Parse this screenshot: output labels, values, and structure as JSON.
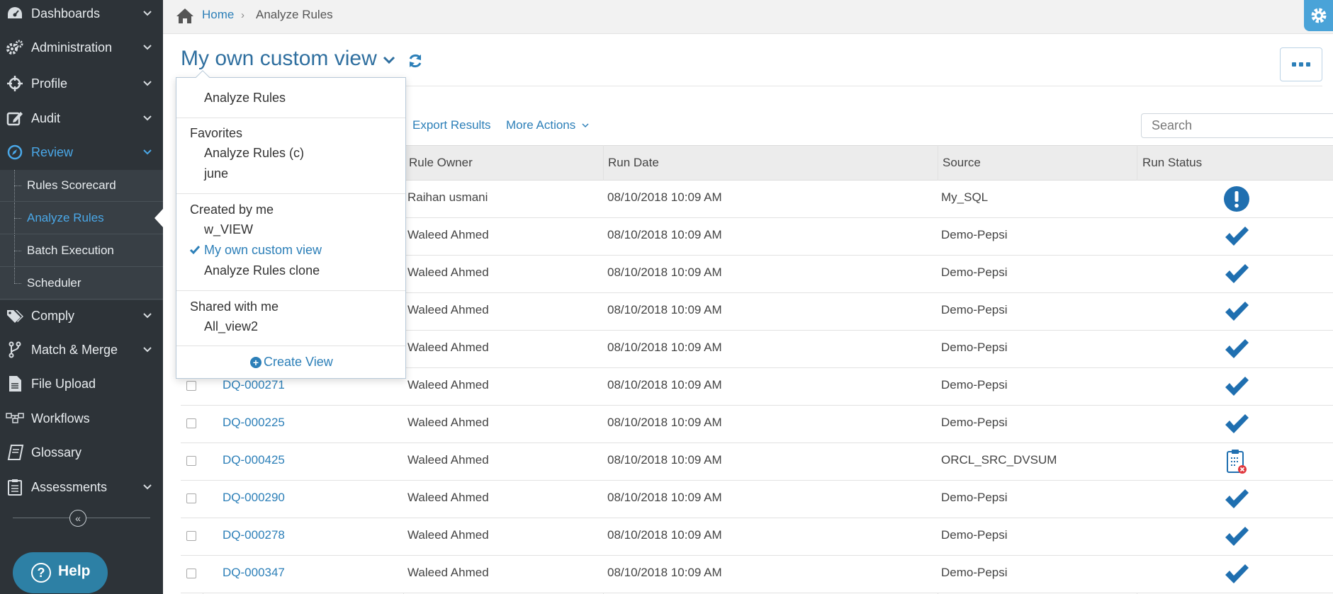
{
  "sidebar": {
    "items": [
      {
        "label": "Dashboards",
        "icon": "dashboard-icon"
      },
      {
        "label": "Administration",
        "icon": "gears-icon"
      },
      {
        "label": "Profile",
        "icon": "crosshair-icon"
      },
      {
        "label": "Audit",
        "icon": "edit-icon"
      },
      {
        "label": "Review",
        "icon": "compass-icon"
      },
      {
        "label": "Comply",
        "icon": "tags-icon"
      },
      {
        "label": "Match & Merge",
        "icon": "merge-icon"
      },
      {
        "label": "File Upload",
        "icon": "file-icon"
      },
      {
        "label": "Workflows",
        "icon": "workflow-icon"
      },
      {
        "label": "Glossary",
        "icon": "book-icon"
      },
      {
        "label": "Assessments",
        "icon": "clipboard-icon"
      }
    ],
    "sub_items": [
      {
        "label": "Rules Scorecard"
      },
      {
        "label": "Analyze Rules"
      },
      {
        "label": "Batch Execution"
      },
      {
        "label": "Scheduler"
      }
    ],
    "help_label": "Help"
  },
  "breadcrumb": {
    "home": "Home",
    "current": "Analyze Rules"
  },
  "view": {
    "title": "My own custom view"
  },
  "actions": {
    "export": "Export Results",
    "more": "More Actions"
  },
  "search": {
    "placeholder": "Search"
  },
  "table": {
    "headers": {
      "owner": "Rule Owner",
      "run_date": "Run Date",
      "source": "Source",
      "status": "Run Status"
    },
    "rows": [
      {
        "id": "",
        "owner": "Raihan usmani",
        "run_date": "08/10/2018 10:09 AM",
        "source": "My_SQL",
        "status": "warning"
      },
      {
        "id": "",
        "owner": "Waleed Ahmed",
        "run_date": "08/10/2018 10:09 AM",
        "source": "Demo-Pepsi",
        "status": "success"
      },
      {
        "id": "",
        "owner": "Waleed Ahmed",
        "run_date": "08/10/2018 10:09 AM",
        "source": "Demo-Pepsi",
        "status": "success"
      },
      {
        "id": "",
        "owner": "Waleed Ahmed",
        "run_date": "08/10/2018 10:09 AM",
        "source": "Demo-Pepsi",
        "status": "success"
      },
      {
        "id": "",
        "owner": "Waleed Ahmed",
        "run_date": "08/10/2018 10:09 AM",
        "source": "Demo-Pepsi",
        "status": "success"
      },
      {
        "id": "DQ-000271",
        "owner": "Waleed Ahmed",
        "run_date": "08/10/2018 10:09 AM",
        "source": "Demo-Pepsi",
        "status": "success"
      },
      {
        "id": "DQ-000225",
        "owner": "Waleed Ahmed",
        "run_date": "08/10/2018 10:09 AM",
        "source": "Demo-Pepsi",
        "status": "success"
      },
      {
        "id": "DQ-000425",
        "owner": "Waleed Ahmed",
        "run_date": "08/10/2018 10:09 AM",
        "source": "ORCL_SRC_DVSUM",
        "status": "failed"
      },
      {
        "id": "DQ-000290",
        "owner": "Waleed Ahmed",
        "run_date": "08/10/2018 10:09 AM",
        "source": "Demo-Pepsi",
        "status": "success"
      },
      {
        "id": "DQ-000278",
        "owner": "Waleed Ahmed",
        "run_date": "08/10/2018 10:09 AM",
        "source": "Demo-Pepsi",
        "status": "success"
      },
      {
        "id": "DQ-000347",
        "owner": "Waleed Ahmed",
        "run_date": "08/10/2018 10:09 AM",
        "source": "Demo-Pepsi",
        "status": "success"
      }
    ]
  },
  "dropdown": {
    "top_item": "Analyze Rules",
    "favorites_header": "Favorites",
    "favorites": [
      "Analyze Rules (c)",
      "june"
    ],
    "created_header": "Created by me",
    "created": [
      "w_VIEW",
      "My own custom view",
      "Analyze Rules clone"
    ],
    "shared_header": "Shared with me",
    "shared": [
      "All_view2"
    ],
    "create_label": "Create View"
  },
  "colors": {
    "accent": "#2c7fb8",
    "sidebar_bg": "#2d3338",
    "active_nav": "#4aa8e8"
  }
}
